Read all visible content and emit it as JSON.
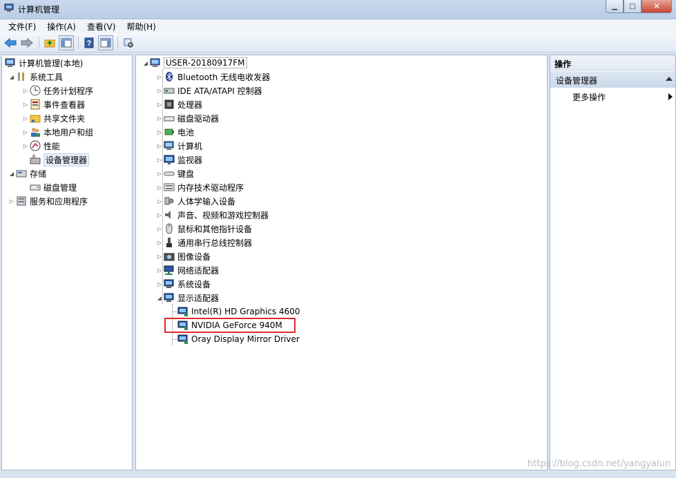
{
  "window": {
    "title": "计算机管理",
    "controls": [
      "minimize",
      "maximize",
      "close"
    ]
  },
  "menubar": {
    "items": [
      "文件(F)",
      "操作(A)",
      "查看(V)",
      "帮助(H)"
    ]
  },
  "toolbar": {
    "buttons": [
      "back-arrow-icon",
      "forward-arrow-icon",
      "up-folder-icon",
      "show-hide-tree-icon",
      "help-icon",
      "action-pane-icon",
      "properties-icon"
    ]
  },
  "left_tree": {
    "root": "计算机管理(本地)",
    "system_tools": "系统工具",
    "task_scheduler": "任务计划程序",
    "event_viewer": "事件查看器",
    "shared_folders": "共享文件夹",
    "local_users": "本地用户和组",
    "performance": "性能",
    "device_manager": "设备管理器",
    "storage": "存储",
    "disk_management": "磁盘管理",
    "services_apps": "服务和应用程序"
  },
  "device_tree": {
    "root": "USER-20180917FM",
    "categories": [
      "Bluetooth 无线电收发器",
      "IDE ATA/ATAPI 控制器",
      "处理器",
      "磁盘驱动器",
      "电池",
      "计算机",
      "监视器",
      "键盘",
      "内存技术驱动程序",
      "人体学输入设备",
      "声音、视频和游戏控制器",
      "鼠标和其他指针设备",
      "通用串行总线控制器",
      "图像设备",
      "网络适配器",
      "系统设备",
      "显示适配器"
    ],
    "display_adapters": [
      "Intel(R) HD Graphics 4600",
      "NVIDIA GeForce 940M",
      "Oray Display Mirror Driver"
    ]
  },
  "actions": {
    "header": "操作",
    "section": "设备管理器",
    "more": "更多操作"
  },
  "watermark": "https://blog.csdn.net/yangyalun",
  "colors": {
    "highlight_box": "#e0292b",
    "selection": "#e5edf6"
  }
}
